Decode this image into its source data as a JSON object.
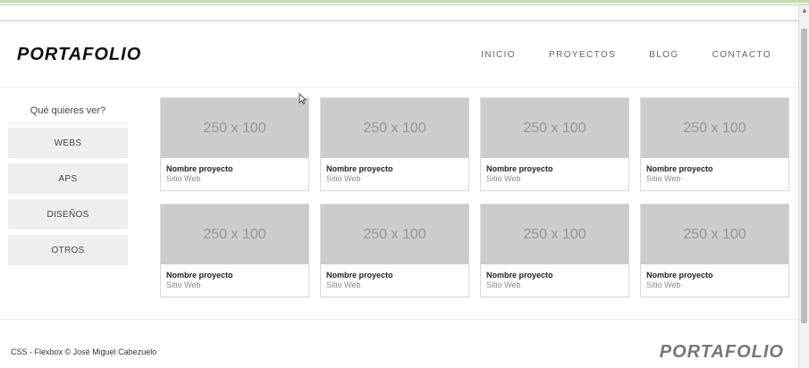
{
  "header": {
    "logo": "PORTAFOLIO",
    "nav": [
      "INICIO",
      "PROYECTOS",
      "BLOG",
      "CONTACTO"
    ]
  },
  "sidebar": {
    "title": "Qué quieres ver?",
    "buttons": [
      "WEBS",
      "APS",
      "DISEÑOS",
      "OTROS"
    ]
  },
  "projects": [
    {
      "thumb": "250 x 100",
      "name": "Nombre proyecto",
      "type": "Sitio Web"
    },
    {
      "thumb": "250 x 100",
      "name": "Nombre proyecto",
      "type": "Sitio Web"
    },
    {
      "thumb": "250 x 100",
      "name": "Nombre proyecto",
      "type": "Sitio Web"
    },
    {
      "thumb": "250 x 100",
      "name": "Nombre proyecto",
      "type": "Sitio Web"
    },
    {
      "thumb": "250 x 100",
      "name": "Nombre proyecto",
      "type": "Sitio Web"
    },
    {
      "thumb": "250 x 100",
      "name": "Nombre proyecto",
      "type": "Sitio Web"
    },
    {
      "thumb": "250 x 100",
      "name": "Nombre proyecto",
      "type": "Sitio Web"
    },
    {
      "thumb": "250 x 100",
      "name": "Nombre proyecto",
      "type": "Sitio Web"
    }
  ],
  "footer": {
    "credit": "CSS - Flexbox © José Miguel Cabezuelo",
    "logo": "PORTAFOLIO"
  },
  "colors": {
    "thumbnail_bg": "#cccccc",
    "button_bg": "#eeeeee",
    "footer_logo": "#777777"
  },
  "icons": {
    "cursor": "mouse-pointer-icon",
    "scroll_up": "chevron-up-icon"
  }
}
